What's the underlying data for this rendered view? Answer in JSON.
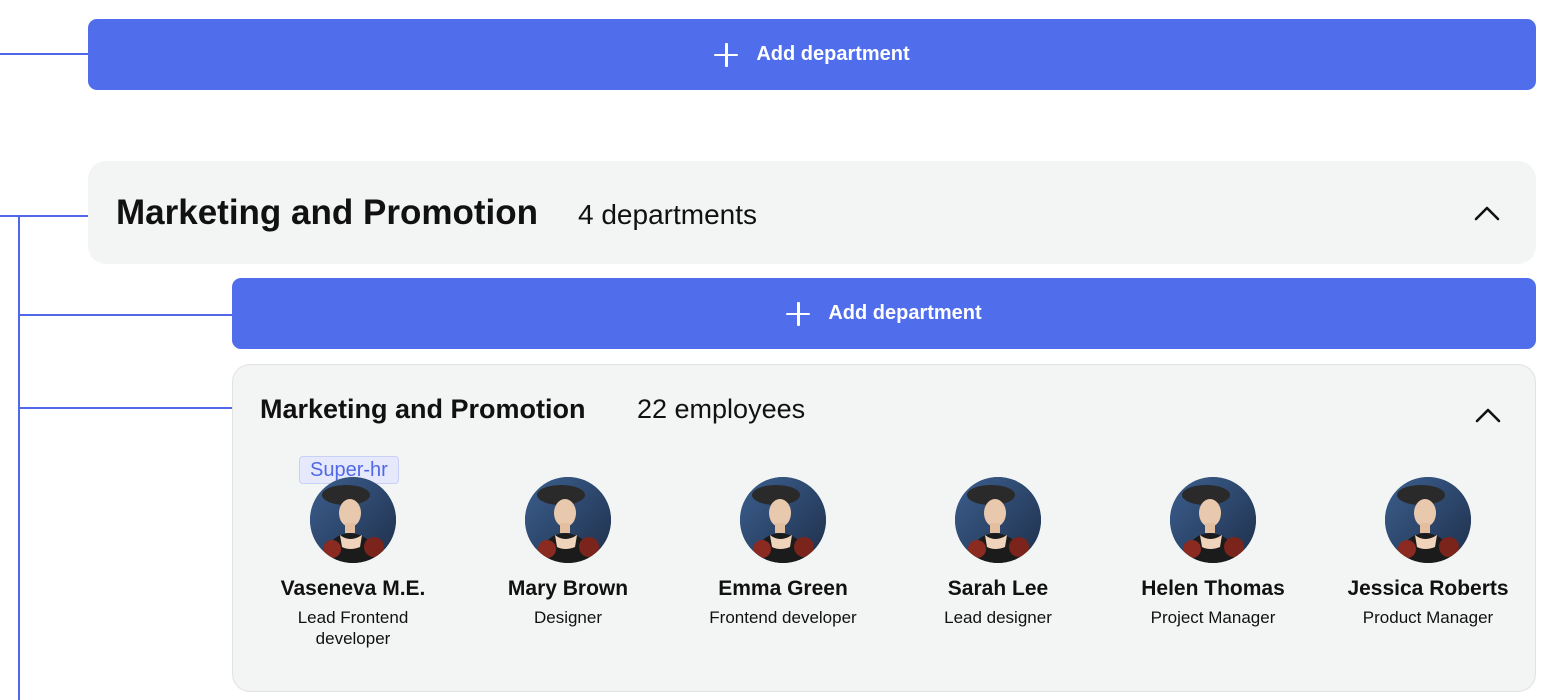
{
  "top_add_button": {
    "label": "Add department"
  },
  "parent_department": {
    "title": "Marketing and Promotion",
    "count_label": "4 departments"
  },
  "child_add_button": {
    "label": "Add department"
  },
  "child_department": {
    "title": "Marketing and Promotion",
    "count_label": "22 employees",
    "badge": "Super-hr",
    "employees": [
      {
        "name": "Vaseneva M.E.",
        "role": "Lead Frontend developer"
      },
      {
        "name": "Mary Brown",
        "role": "Designer"
      },
      {
        "name": "Emma Green",
        "role": "Frontend developer"
      },
      {
        "name": "Sarah Lee",
        "role": "Lead designer"
      },
      {
        "name": "Helen Thomas",
        "role": "Project Manager"
      },
      {
        "name": "Jessica Roberts",
        "role": "Product Manager"
      }
    ]
  },
  "colors": {
    "accent": "#506deb",
    "connector": "#5068e8",
    "card_background": "#f3f4f4",
    "badge_background": "#e6e9fb"
  },
  "icons": [
    "plus-icon",
    "chevron-up-icon",
    "avatar"
  ]
}
